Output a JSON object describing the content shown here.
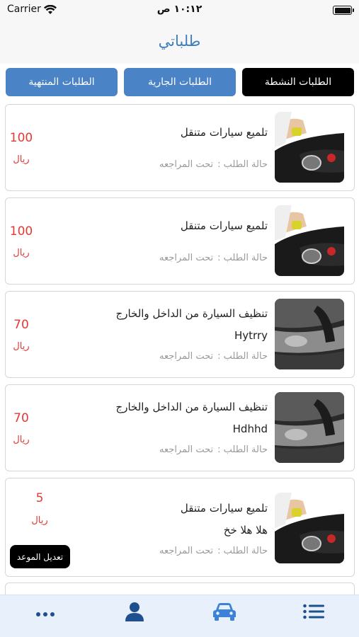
{
  "status_bar": {
    "carrier": "Carrier",
    "time": "١٠:١٢ ص"
  },
  "header": {
    "title": "طلباتي"
  },
  "tabs": [
    {
      "label": "الطلبات النشطة",
      "active": true
    },
    {
      "label": "الطلبات الجارية",
      "active": false
    },
    {
      "label": "الطلبات المنتهية",
      "active": false
    }
  ],
  "status_label": "حالة الطلب :",
  "orders": [
    {
      "title": "تلميع سيارات متنقل",
      "subtitle": "",
      "status": "تحت المراجعه",
      "price": "100",
      "currency": "ريال",
      "image": "polishing-photo"
    },
    {
      "title": "تلميع سيارات متنقل",
      "subtitle": "",
      "status": "تحت المراجعه",
      "price": "100",
      "currency": "ريال",
      "image": "polishing-photo"
    },
    {
      "title": "تنظيف السيارة من الداخل والخارج",
      "subtitle": "Hytrry",
      "status": "تحت المراجعه",
      "price": "70",
      "currency": "ريال",
      "image": "cleaning-photo"
    },
    {
      "title": "تنظيف السيارة من الداخل والخارج",
      "subtitle": "Hdhhd",
      "status": "تحت المراجعه",
      "price": "70",
      "currency": "ريال",
      "image": "cleaning-photo"
    },
    {
      "title": "تلميع سيارات متنقل",
      "subtitle": "هلا هلا خخ",
      "status": "تحت المراجعه",
      "price": "5",
      "currency": "ريال",
      "image": "polishing-photo",
      "edit_label": "تعديل الموعد"
    }
  ],
  "bottom_tabs": [
    {
      "icon": "more-dots-icon"
    },
    {
      "icon": "profile-icon"
    },
    {
      "icon": "car-icon",
      "selected": true
    },
    {
      "icon": "list-icon"
    }
  ],
  "colors": {
    "accent": "#3e7dc0",
    "tab_button": "#4a83c6",
    "active_tab": "#000000",
    "price": "#e53935",
    "tabbar_bg": "#e8f1fb",
    "icon_dark": "#1e4f8f",
    "icon_selected": "#3b82d8"
  }
}
